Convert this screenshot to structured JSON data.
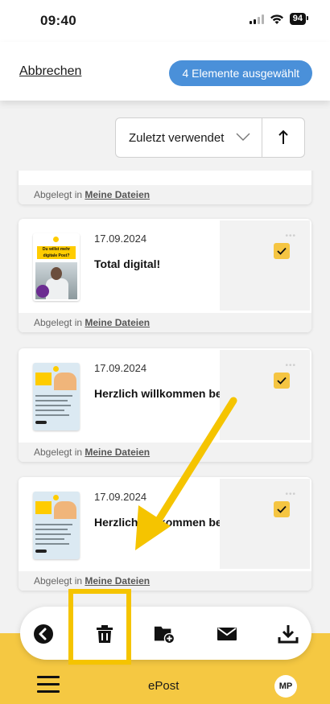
{
  "status_bar": {
    "time": "09:40",
    "battery": "94"
  },
  "header": {
    "cancel_label": "Abbrechen",
    "selected_label": "4 Elemente ausgewählt"
  },
  "sort": {
    "selected_value": "Zuletzt verwendet",
    "direction_icon": "arrow-up-icon"
  },
  "items": [
    {
      "date": "",
      "title": "",
      "filed_prefix": "Abgelegt in",
      "filed_folder": "Meine Dateien",
      "selected": true
    },
    {
      "date": "17.09.2024",
      "title": "Total digital!",
      "thumb_text": "Du willst mehr digitale Post?",
      "filed_prefix": "Abgelegt in",
      "filed_folder": "Meine Dateien",
      "selected": true
    },
    {
      "date": "17.09.2024",
      "title": "Herzlich willkommen bei ePost!",
      "thumb_text": "Herzlich willkommen bei ePost",
      "filed_prefix": "Abgelegt in",
      "filed_folder": "Meine Dateien",
      "selected": true
    },
    {
      "date": "17.09.2024",
      "title": "Herzlich willkommen bei ePost!",
      "thumb_text": "Herzlich willkommen bei ePost",
      "filed_prefix": "Abgelegt in",
      "filed_folder": "Meine Dateien",
      "selected": true
    }
  ],
  "toolbar": {
    "actions": [
      "back-icon",
      "trash-icon",
      "folder-add-icon",
      "mail-icon",
      "download-icon"
    ]
  },
  "bottom_nav": {
    "title": "ePost",
    "avatar_initials": "MP"
  },
  "colors": {
    "accent_yellow": "#f5c842",
    "pill_blue": "#4a90d9",
    "checkbox_yellow": "#f5c542"
  }
}
